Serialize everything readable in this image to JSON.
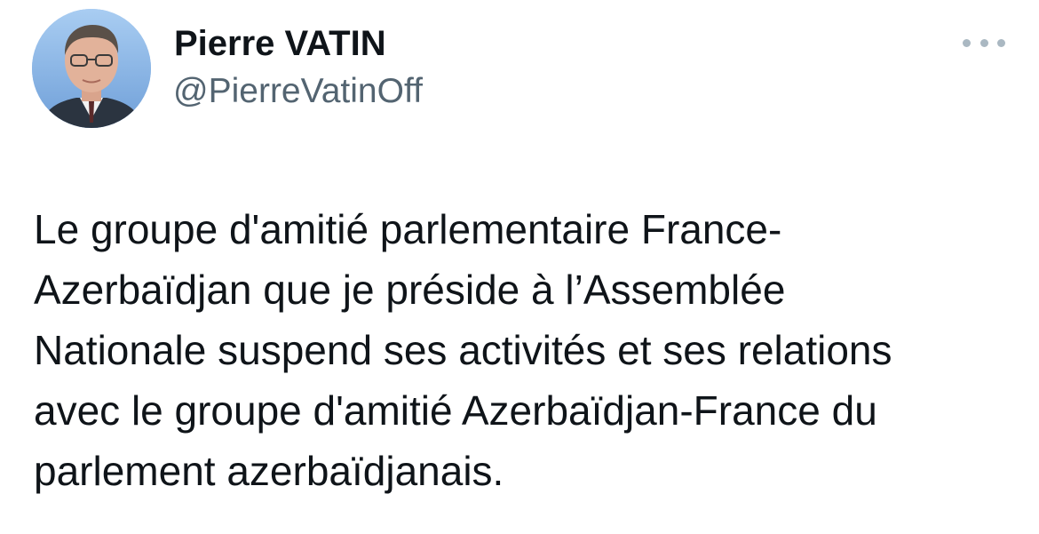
{
  "author": {
    "display_name": "Pierre VATIN",
    "handle": "@PierreVatinOff",
    "avatar_icon": "profile-photo"
  },
  "menu": {
    "icon": "more-options-icon"
  },
  "tweet": {
    "lines": [
      "Le groupe d'amitié parlementaire France-",
      "Azerbaïdjan que je préside à l’Assemblée",
      "Nationale suspend ses activités et ses relations",
      "avec le groupe d'amitié Azerbaïdjan-France du",
      "parlement azerbaïdjanais."
    ]
  },
  "colors": {
    "name": "#0f1419",
    "handle": "#536471",
    "menu_dots": "#aab8c2",
    "avatar_bg": "#8fb8e8"
  }
}
